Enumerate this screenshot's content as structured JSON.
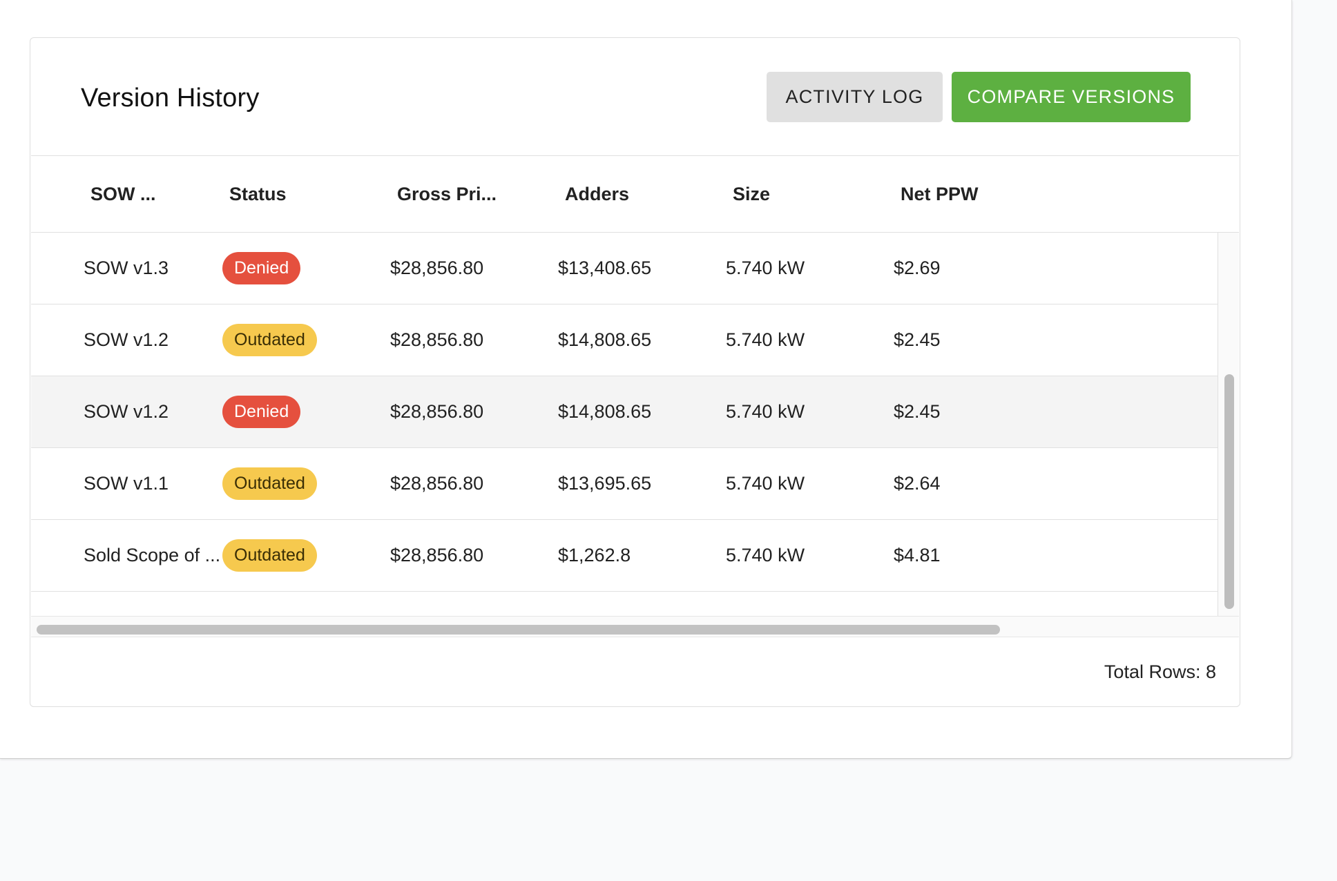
{
  "title": "Version History",
  "buttons": {
    "activity_log": "ACTIVITY LOG",
    "compare_versions": "COMPARE VERSIONS"
  },
  "colors": {
    "compare_button": "#5db041",
    "denied_badge": "#e5503e",
    "outdated_badge": "#f6c94e"
  },
  "table": {
    "columns": [
      "SOW ...",
      "Status",
      "Gross Pri...",
      "Adders",
      "Size",
      "Net PPW"
    ],
    "rows": [
      {
        "name": "SOW v1.3",
        "status": "Denied",
        "gross": "$28,856.80",
        "adders": "$13,408.65",
        "size": "5.740 kW",
        "ppw": "$2.69"
      },
      {
        "name": "SOW v1.2",
        "status": "Outdated",
        "gross": "$28,856.80",
        "adders": "$14,808.65",
        "size": "5.740 kW",
        "ppw": "$2.45"
      },
      {
        "name": "SOW v1.2",
        "status": "Denied",
        "gross": "$28,856.80",
        "adders": "$14,808.65",
        "size": "5.740 kW",
        "ppw": "$2.45"
      },
      {
        "name": "SOW v1.1",
        "status": "Outdated",
        "gross": "$28,856.80",
        "adders": "$13,695.65",
        "size": "5.740 kW",
        "ppw": "$2.64"
      },
      {
        "name": "Sold Scope of ...",
        "status": "Outdated",
        "gross": "$28,856.80",
        "adders": "$1,262.8",
        "size": "5.740 kW",
        "ppw": "$4.81"
      }
    ],
    "footer": "Total Rows: 8"
  }
}
